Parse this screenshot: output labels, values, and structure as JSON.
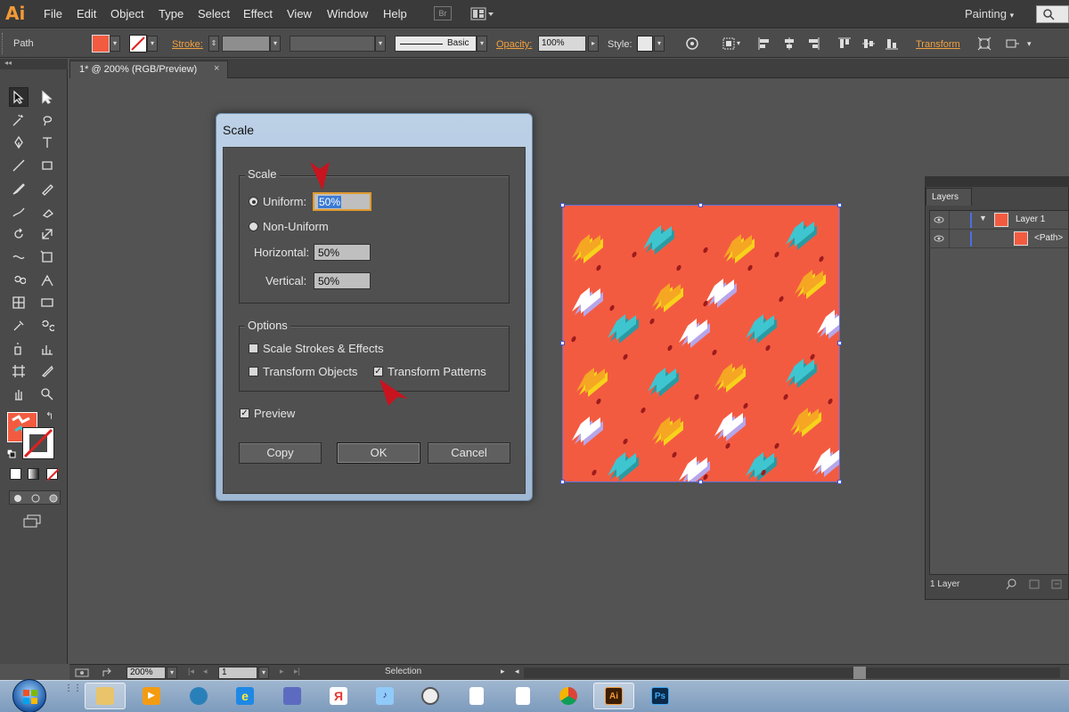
{
  "app": {
    "logo": "Ai",
    "menu": [
      "File",
      "Edit",
      "Object",
      "Type",
      "Select",
      "Effect",
      "View",
      "Window",
      "Help"
    ],
    "bridge_label": "Br",
    "workspace": "Painting"
  },
  "control_bar": {
    "selection_label": "Path",
    "stroke_label": "Stroke:",
    "brush_label": "Basic",
    "opacity_label": "Opacity:",
    "opacity_value": "100%",
    "style_label": "Style:",
    "transform_label": "Transform"
  },
  "document_tab": {
    "title": "1* @ 200% (RGB/Preview)",
    "close": "×"
  },
  "scale_dialog": {
    "title": "Scale",
    "scale_group": "Scale",
    "uniform_label": "Uniform:",
    "uniform_value": "50%",
    "non_uniform_label": "Non-Uniform",
    "horizontal_label": "Horizontal:",
    "horizontal_value": "50%",
    "vertical_label": "Vertical:",
    "vertical_value": "50%",
    "options_group": "Options",
    "scale_strokes_label": "Scale Strokes & Effects",
    "transform_objects_label": "Transform Objects",
    "transform_patterns_label": "Transform Patterns",
    "preview_label": "Preview",
    "copy_button": "Copy",
    "ok_button": "OK",
    "cancel_button": "Cancel"
  },
  "layers_panel": {
    "tab": "Layers",
    "rows": [
      {
        "name": "Layer 1"
      },
      {
        "name": "<Path>"
      }
    ],
    "footer": "1 Layer"
  },
  "status_bar": {
    "zoom": "200%",
    "page": "1",
    "tool": "Selection"
  },
  "colors": {
    "artwork_bg": "#f35b41",
    "accent_orange": "#f29a36",
    "selection_blue": "#5d6fd8"
  },
  "taskbar": {
    "icons": [
      "folder-icon",
      "media-player-icon",
      "media-center-icon",
      "internet-explorer-icon",
      "network-icon",
      "yandex-icon",
      "speaker-icon",
      "circle-app-icon",
      "document-icon",
      "document-icon",
      "chrome-icon",
      "illustrator-icon",
      "photoshop-icon"
    ],
    "ai_label": "Ai",
    "ps_label": "Ps",
    "yandex_label": "Я"
  }
}
